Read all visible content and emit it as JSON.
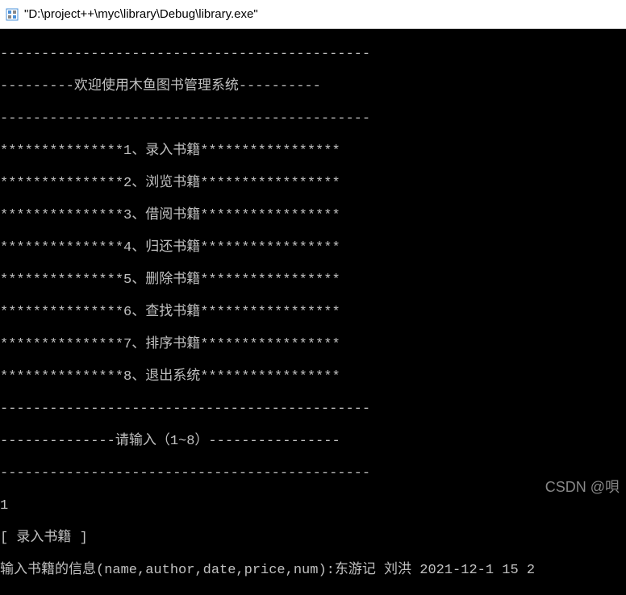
{
  "window": {
    "title": "\"D:\\project++\\myc\\library\\Debug\\library.exe\""
  },
  "console": {
    "lines": [
      "---------------------------------------------",
      "---------欢迎使用木鱼图书管理系统----------",
      "---------------------------------------------",
      "***************1、录入书籍*****************",
      "***************2、浏览书籍*****************",
      "***************3、借阅书籍*****************",
      "***************4、归还书籍*****************",
      "***************5、删除书籍*****************",
      "***************6、查找书籍*****************",
      "***************7、排序书籍*****************",
      "***************8、退出系统*****************",
      "---------------------------------------------",
      "--------------请输入（1~8）----------------",
      "---------------------------------------------",
      "1",
      "[ 录入书籍 ]",
      "输入书籍的信息(name,author,date,price,num):东游记 刘洪 2021-12-1 15 2"
    ]
  },
  "watermark": {
    "text": "CSDN @唄"
  }
}
